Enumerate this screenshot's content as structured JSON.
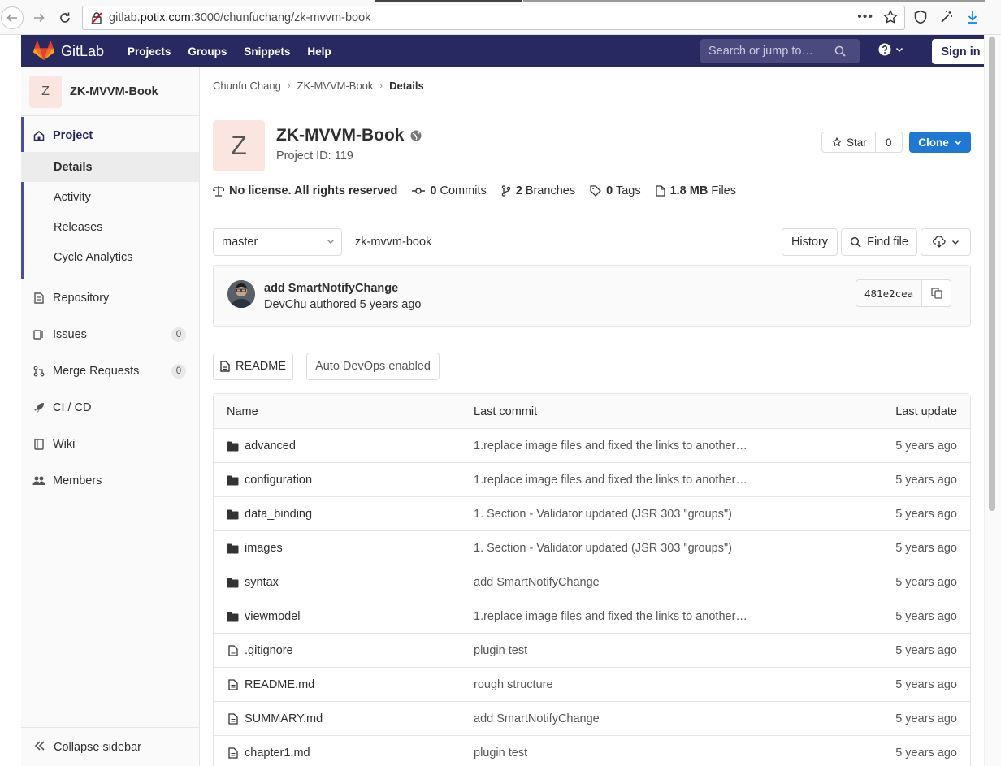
{
  "browser": {
    "url_prefix": "gitlab.",
    "url_host": "potix.com",
    "url_rest": ":3000/chunfuchang/zk-mvvm-book"
  },
  "topnav": {
    "logo_text": "GitLab",
    "links": [
      "Projects",
      "Groups",
      "Snippets",
      "Help"
    ],
    "search_placeholder": "Search or jump to…",
    "signin": "Sign in"
  },
  "sidebar": {
    "project_initial": "Z",
    "project_name": "ZK-MVVM-Book",
    "project_label": "Project",
    "subitems": [
      "Details",
      "Activity",
      "Releases",
      "Cycle Analytics"
    ],
    "items": [
      {
        "label": "Repository"
      },
      {
        "label": "Issues",
        "badge": "0"
      },
      {
        "label": "Merge Requests",
        "badge": "0"
      },
      {
        "label": "CI / CD"
      },
      {
        "label": "Wiki"
      },
      {
        "label": "Members"
      }
    ],
    "collapse": "Collapse sidebar"
  },
  "breadcrumb": [
    "Chunfu Chang",
    "ZK-MVVM-Book",
    "Details"
  ],
  "project": {
    "initial": "Z",
    "title": "ZK-MVVM-Book",
    "id_text": "Project ID: 119",
    "star_label": "Star",
    "star_count": "0",
    "clone_label": "Clone"
  },
  "stats": {
    "license": "No license. All rights reserved",
    "commits_count": "0",
    "commits_label": "Commits",
    "branches_count": "2",
    "branches_label": "Branches",
    "tags_count": "0",
    "tags_label": "Tags",
    "files_size": "1.8 MB",
    "files_label": "Files"
  },
  "repo": {
    "branch": "master",
    "path": "zk-mvvm-book",
    "history": "History",
    "find_file": "Find file"
  },
  "commit": {
    "message": "add SmartNotifyChange",
    "meta": "DevChu authored 5 years ago",
    "sha": "481e2cea"
  },
  "buttons": {
    "readme": "README",
    "devops": "Auto DevOps enabled"
  },
  "table": {
    "headers": [
      "Name",
      "Last commit",
      "Last update"
    ],
    "rows": [
      {
        "name": "advanced",
        "type": "folder",
        "commit": "1.replace image files and fixed the links to another…",
        "updated": "5 years ago"
      },
      {
        "name": "configuration",
        "type": "folder",
        "commit": "1.replace image files and fixed the links to another…",
        "updated": "5 years ago"
      },
      {
        "name": "data_binding",
        "type": "folder",
        "commit": "1. Section - Validator updated (JSR 303 \"groups\")",
        "updated": "5 years ago"
      },
      {
        "name": "images",
        "type": "folder",
        "commit": "1. Section - Validator updated (JSR 303 \"groups\")",
        "updated": "5 years ago"
      },
      {
        "name": "syntax",
        "type": "folder",
        "commit": "add SmartNotifyChange",
        "updated": "5 years ago"
      },
      {
        "name": "viewmodel",
        "type": "folder",
        "commit": "1.replace image files and fixed the links to another…",
        "updated": "5 years ago"
      },
      {
        "name": ".gitignore",
        "type": "file",
        "commit": "plugin test",
        "updated": "5 years ago"
      },
      {
        "name": "README.md",
        "type": "file",
        "commit": "rough structure",
        "updated": "5 years ago"
      },
      {
        "name": "SUMMARY.md",
        "type": "file",
        "commit": "add SmartNotifyChange",
        "updated": "5 years ago"
      },
      {
        "name": "chapter1.md",
        "type": "file",
        "commit": "plugin test",
        "updated": "5 years ago"
      }
    ]
  }
}
